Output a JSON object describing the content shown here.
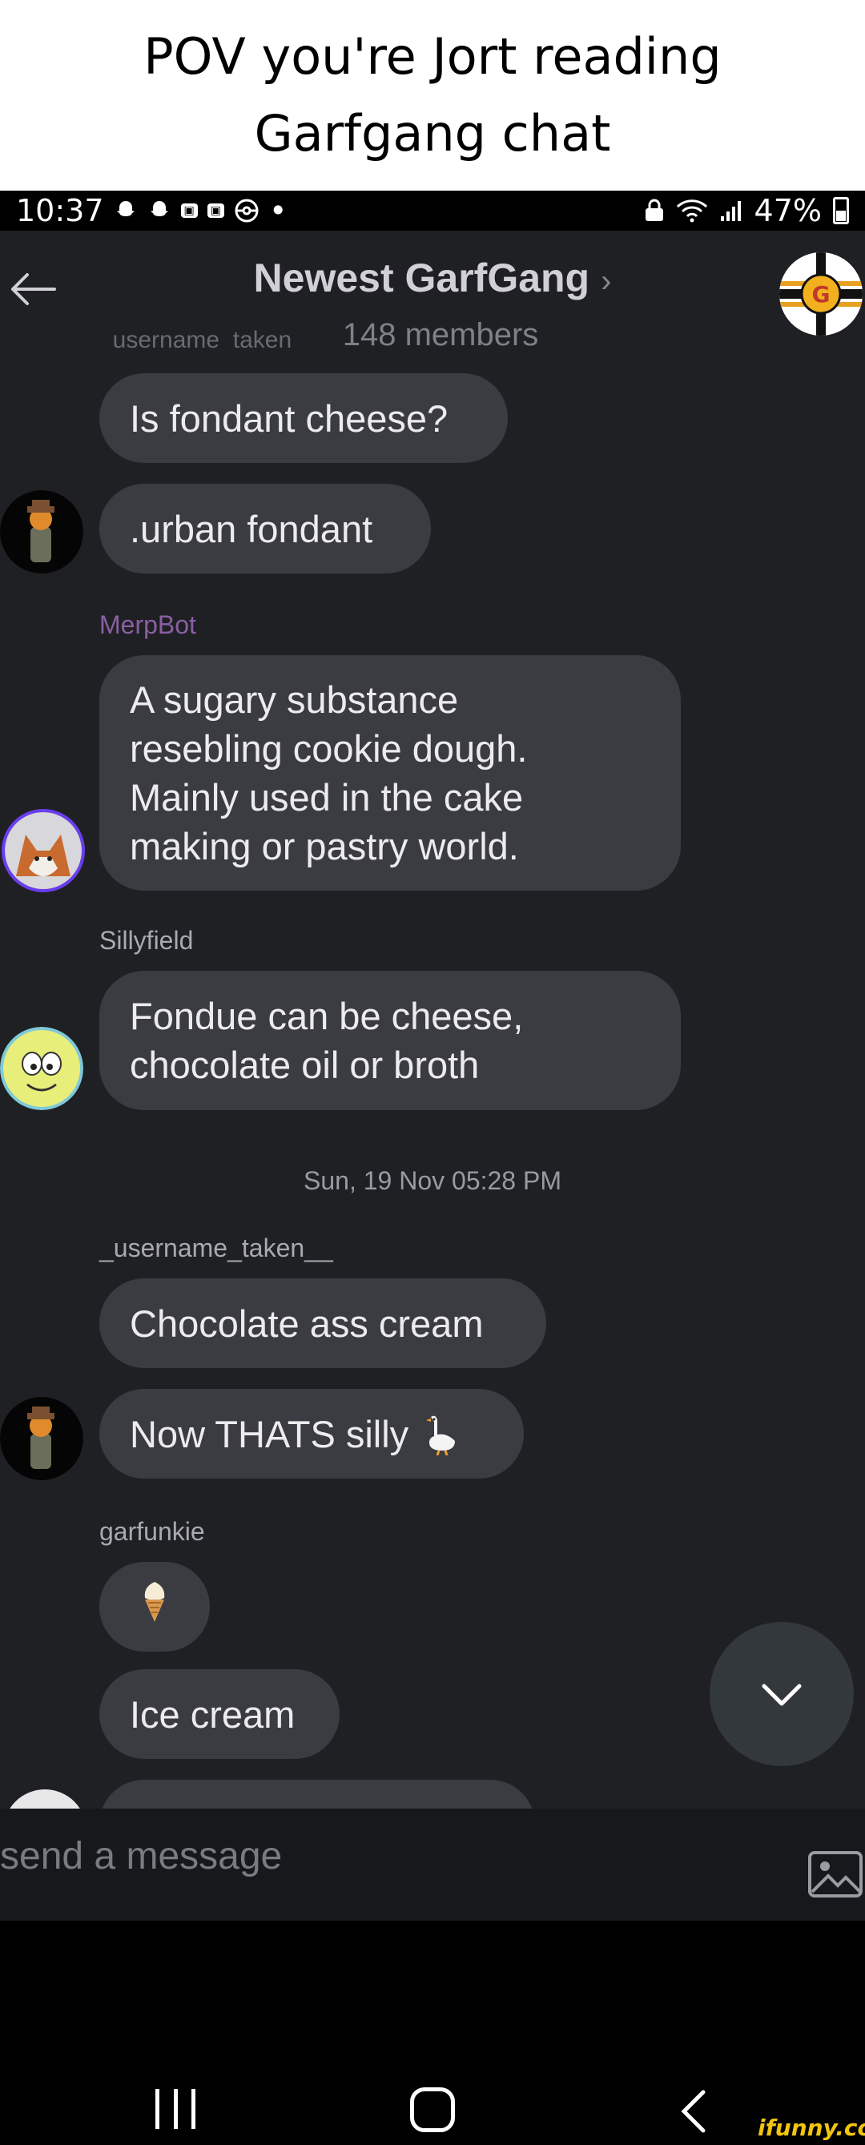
{
  "caption": {
    "line1": "POV you're Jort reading",
    "line2": "Garfgang chat"
  },
  "status_bar": {
    "time": "10:37",
    "battery": "47%"
  },
  "header": {
    "title": "Newest GarfGang",
    "title_chevron": "›",
    "members": "148 members",
    "clipped_username": "_username_taken__"
  },
  "messages": [
    {
      "text": "Is fondant cheese?"
    },
    {
      "text": ".urban fondant"
    },
    {
      "username": "MerpBot",
      "lines": [
        "A sugary substance",
        "resebling cookie dough.",
        "Mainly used in the cake",
        "making or pastry world."
      ]
    },
    {
      "username": "Sillyfield",
      "lines": [
        "Fondue can be cheese,",
        "chocolate oil or broth"
      ]
    },
    {
      "date": "Sun, 19 Nov 05:28 PM"
    },
    {
      "username": "_username_taken__",
      "text": "Chocolate ass cream"
    },
    {
      "text": "Now THATS silly",
      "emoji": "goose"
    },
    {
      "username": "garfunkie",
      "emoji": "ice-cream"
    },
    {
      "text": "Ice cream"
    }
  ],
  "composer": {
    "placeholder": "send a message"
  },
  "watermark": "ifunny.co",
  "colors": {
    "background": "#1f2024",
    "bubble": "#3b3c41",
    "merpbot_name": "#8a5fa3"
  }
}
